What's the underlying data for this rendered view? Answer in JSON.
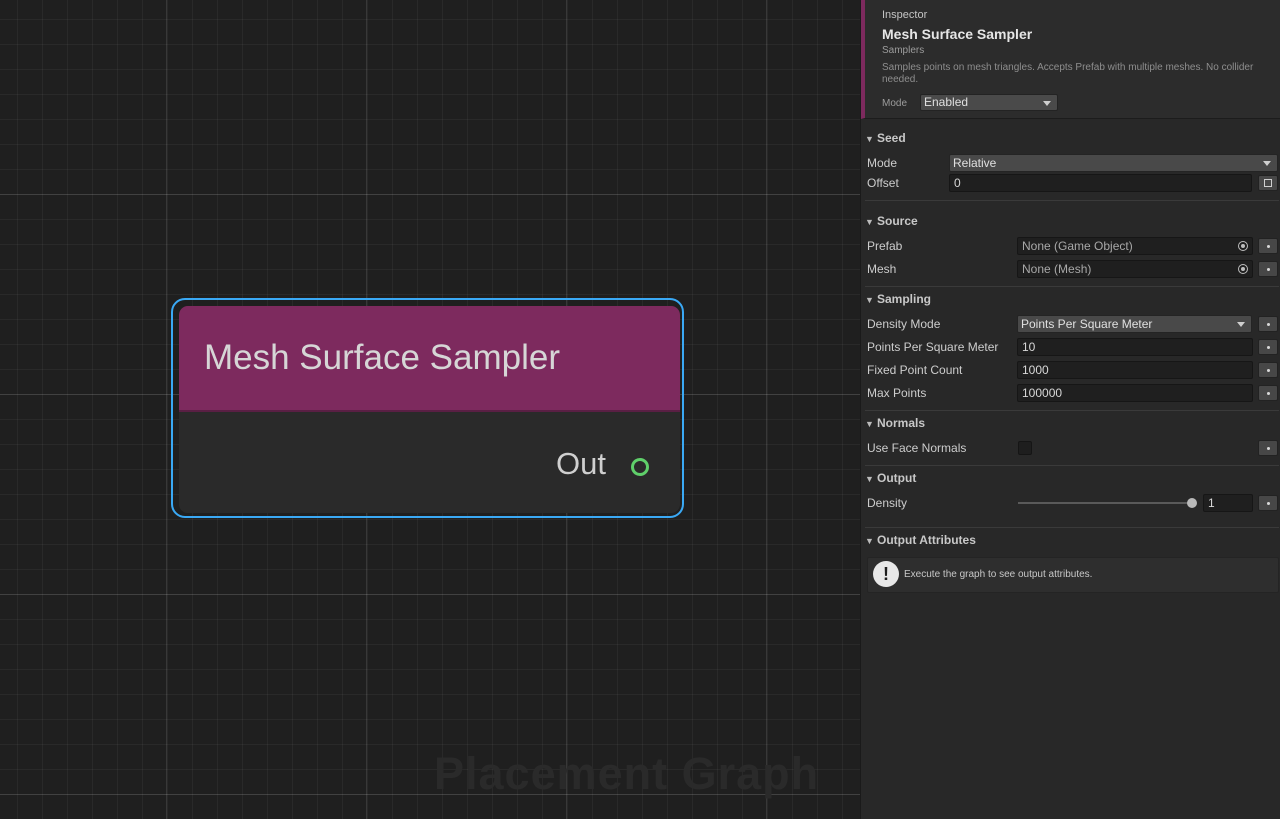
{
  "graph": {
    "watermark": "Placement Graph",
    "node": {
      "title": "Mesh Surface Sampler",
      "header_color": "#7d2a5e",
      "selection_color": "#3aa9f5",
      "output_port": {
        "label": "Out",
        "color": "#5fcf6a"
      }
    }
  },
  "inspector": {
    "label": "Inspector",
    "title": "Mesh Surface Sampler",
    "category": "Samplers",
    "description": "Samples points on mesh triangles. Accepts Prefab with multiple meshes. No collider needed.",
    "mode_label": "Mode",
    "mode_value": "Enabled",
    "sections": {
      "seed": {
        "title": "Seed",
        "mode_label": "Mode",
        "mode_value": "Relative",
        "offset_label": "Offset",
        "offset_value": "0"
      },
      "source": {
        "title": "Source",
        "prefab_label": "Prefab",
        "prefab_value": "None (Game Object)",
        "mesh_label": "Mesh",
        "mesh_value": "None (Mesh)"
      },
      "sampling": {
        "title": "Sampling",
        "density_mode_label": "Density Mode",
        "density_mode_value": "Points Per Square Meter",
        "pps_label": "Points Per Square Meter",
        "pps_value": "10",
        "fixed_label": "Fixed Point Count",
        "fixed_value": "1000",
        "max_label": "Max Points",
        "max_value": "100000"
      },
      "normals": {
        "title": "Normals",
        "use_face_label": "Use Face Normals",
        "use_face_checked": false
      },
      "output": {
        "title": "Output",
        "density_label": "Density",
        "density_value": "1",
        "density_slider_fraction": 1.0
      },
      "output_attributes": {
        "title": "Output Attributes",
        "info_text": "Execute the graph to see output attributes."
      }
    }
  }
}
